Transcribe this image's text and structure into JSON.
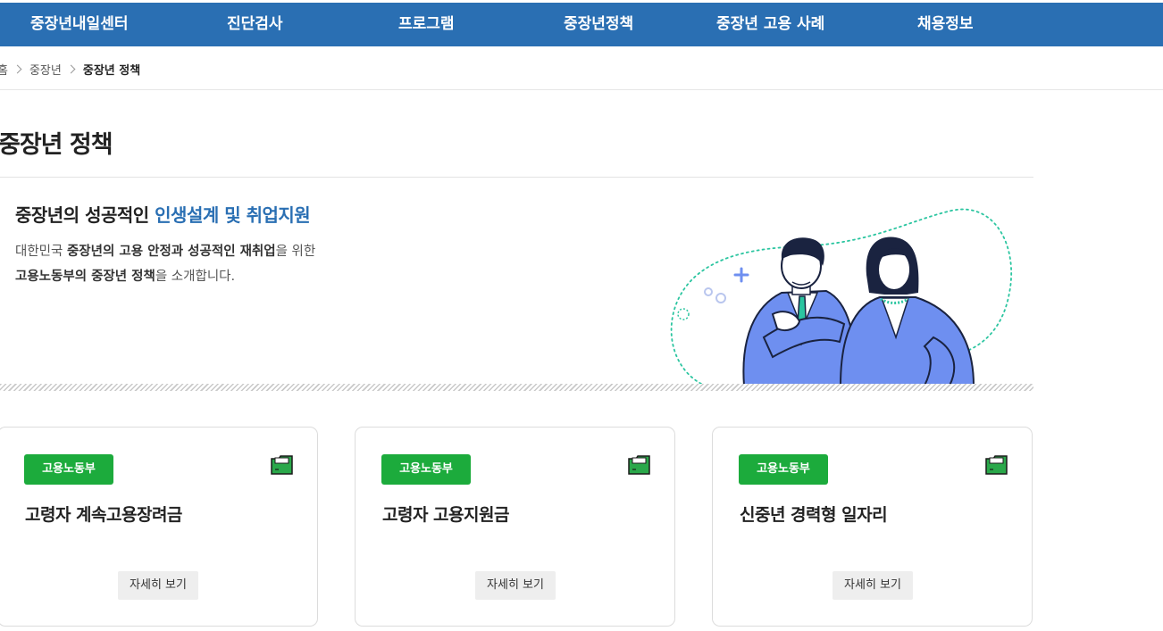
{
  "nav": {
    "items": [
      {
        "label": "중장년내일센터"
      },
      {
        "label": "진단검사"
      },
      {
        "label": "프로그램"
      },
      {
        "label": "중장년정책"
      },
      {
        "label": "중장년 고용 사례"
      },
      {
        "label": "채용정보"
      }
    ]
  },
  "breadcrumb": {
    "home": "홈",
    "parent": "중장년",
    "current": "중장년 정책"
  },
  "page": {
    "title": "중장년 정책"
  },
  "hero": {
    "heading_plain": "중장년의 성공적인 ",
    "heading_accent": "인생설계 및 취업지원",
    "desc_line1": {
      "part1": "대한민국 ",
      "bold1": "중장년의 고용 안정과 성공적인 재취업",
      "part2": "을 위한"
    },
    "desc_line2": {
      "bold1": "고용노동부의 중장년 정책",
      "part1": "을 소개합니다."
    }
  },
  "cards": [
    {
      "badge": "고용노동부",
      "title": "고령자 계속고용장려금",
      "button": "자세히 보기",
      "icon": "folder-icon"
    },
    {
      "badge": "고용노동부",
      "title": "고령자 고용지원금",
      "button": "자세히 보기",
      "icon": "folder-icon"
    },
    {
      "badge": "고용노동부",
      "title": "신중년 경력형 일자리",
      "button": "자세히 보기",
      "icon": "folder-icon"
    }
  ],
  "colors": {
    "nav_bg": "#2a6fb3",
    "accent": "#2a6fb3",
    "badge_bg": "#1cab3c",
    "illustration_jacket": "#6e8ff0",
    "illustration_dots": "#2bc5a0"
  }
}
